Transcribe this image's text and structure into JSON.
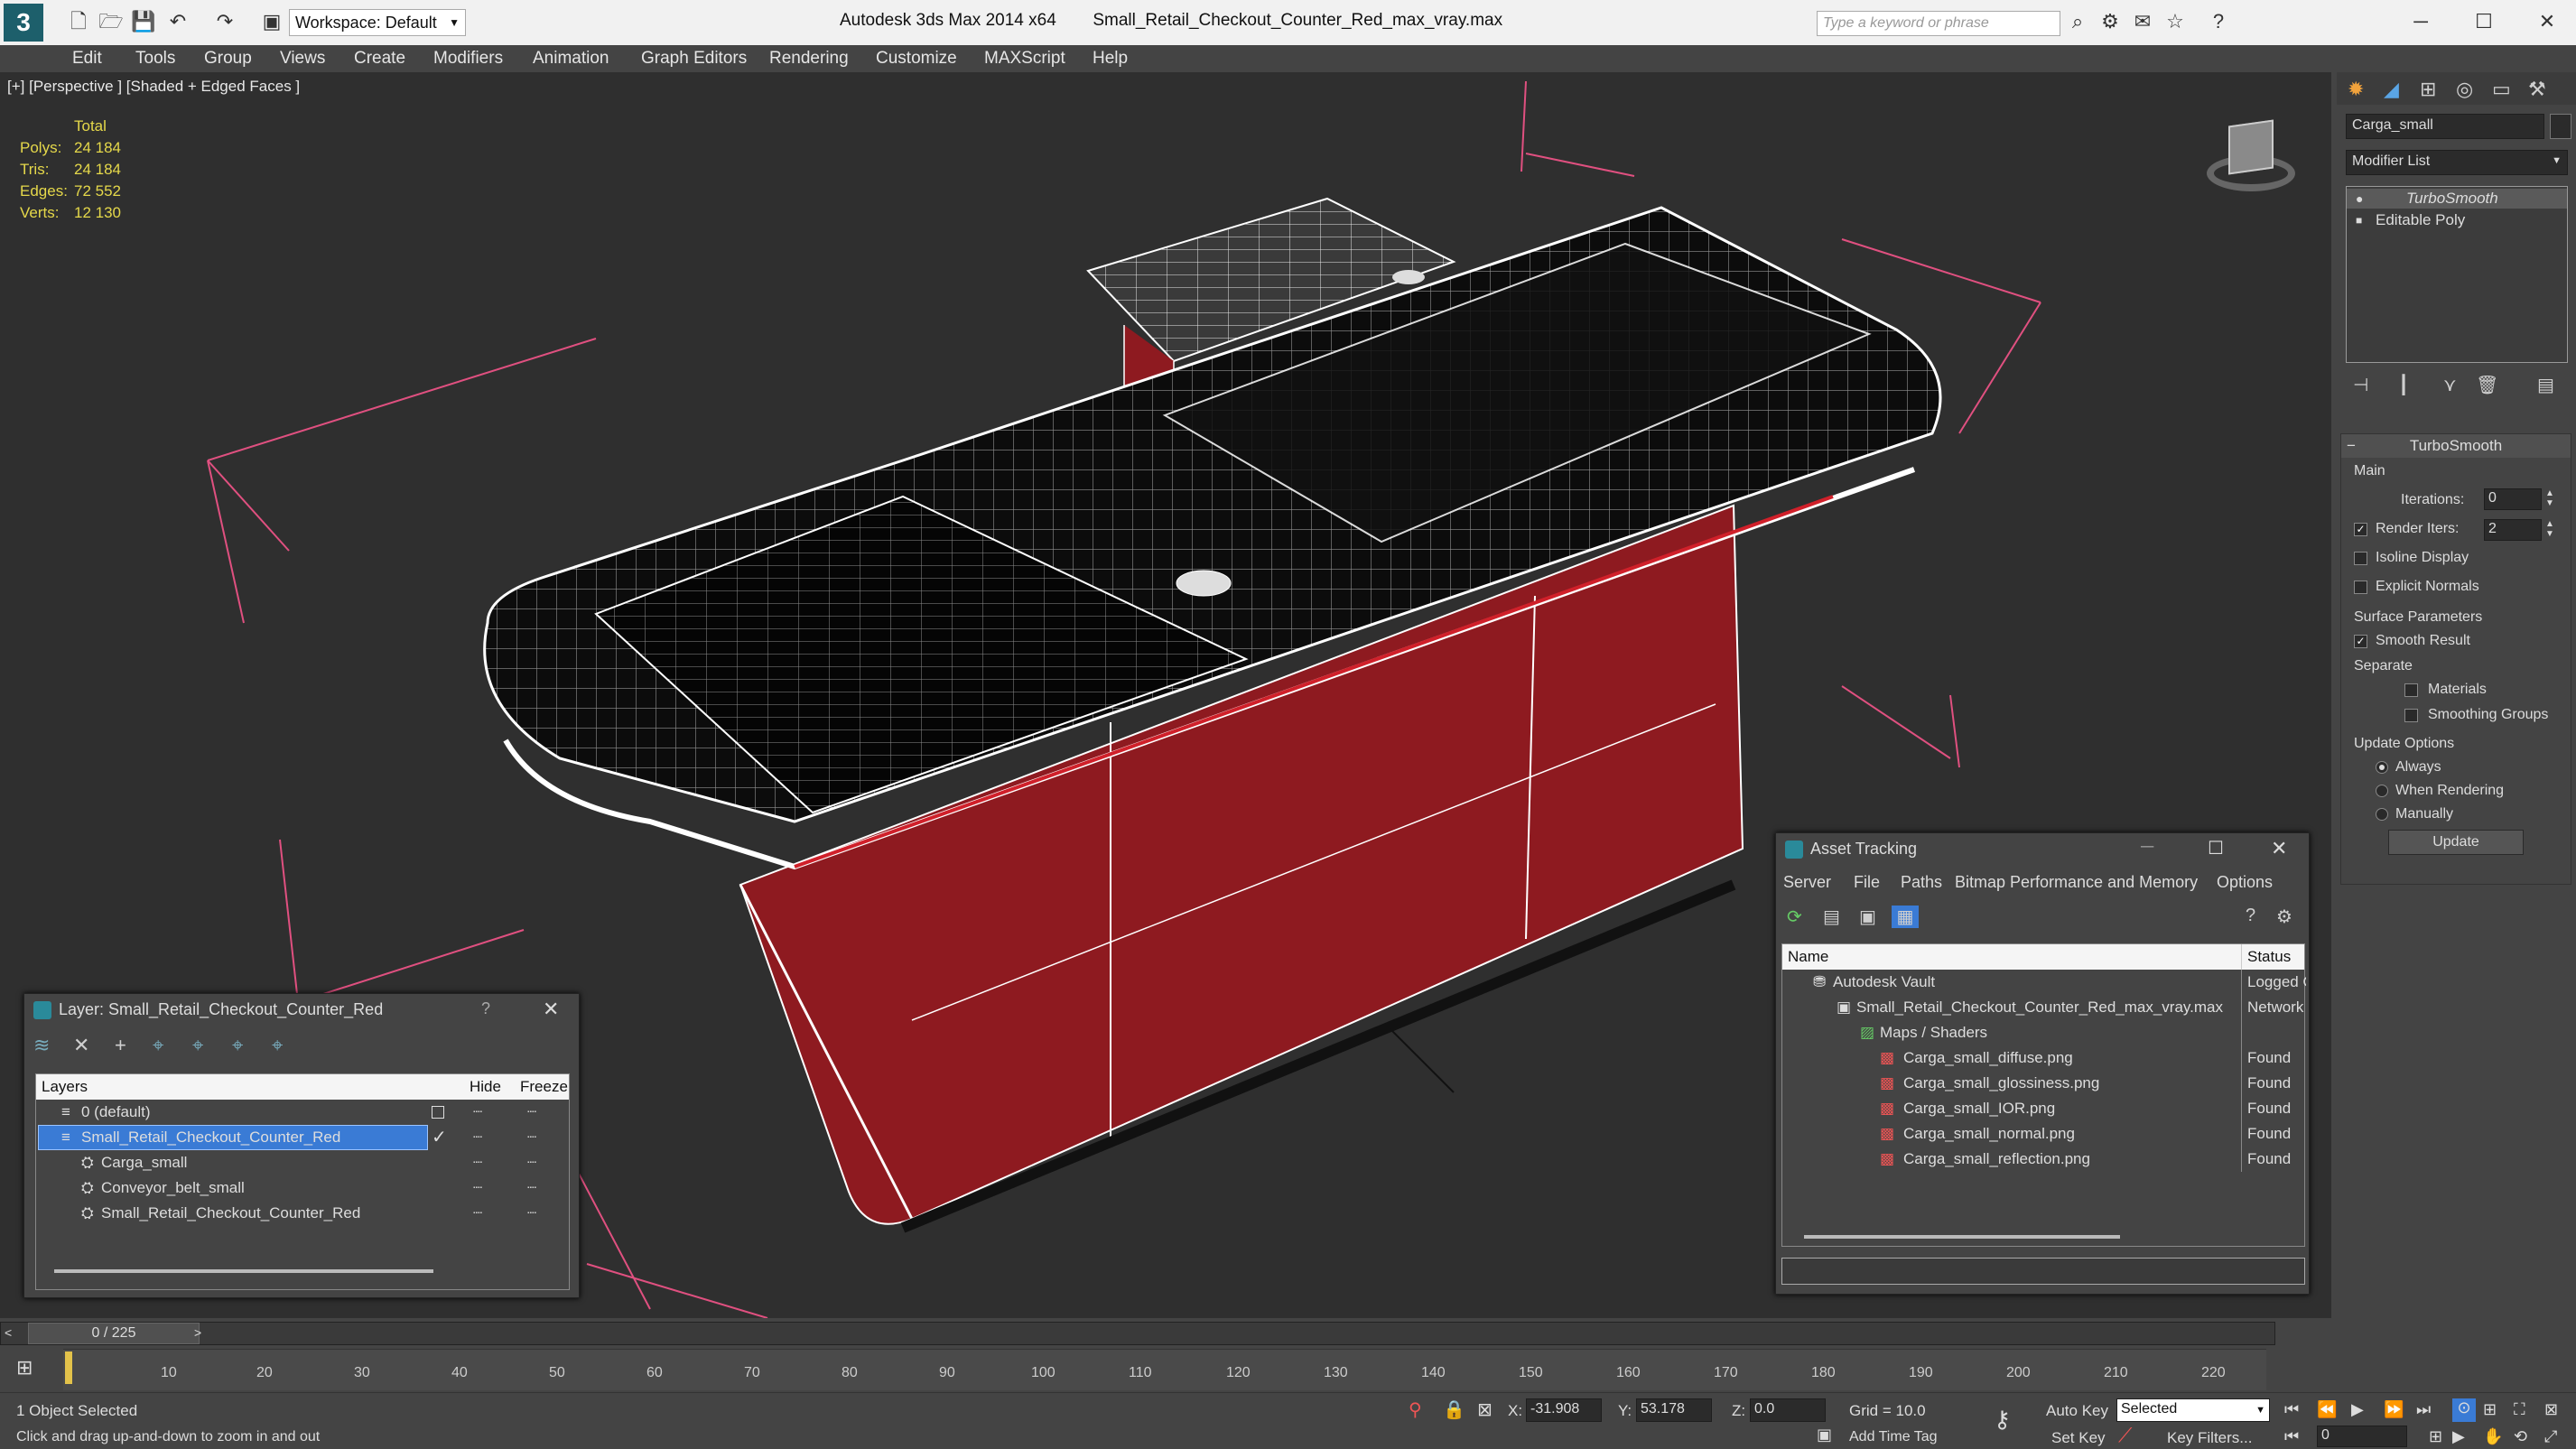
{
  "app": {
    "title": "Autodesk 3ds Max  2014 x64",
    "file": "Small_Retail_Checkout_Counter_Red_max_vray.max",
    "workspace": "Workspace: Default",
    "search_placeholder": "Type a keyword or phrase"
  },
  "menu": [
    "Edit",
    "Tools",
    "Group",
    "Views",
    "Create",
    "Modifiers",
    "Animation",
    "Graph Editors",
    "Rendering",
    "Customize",
    "MAXScript",
    "Help"
  ],
  "viewport": {
    "label": "[+] [Perspective ] [Shaded + Edged Faces ]",
    "stats": {
      "header": "Total",
      "rows": [
        {
          "label": "Polys:",
          "value": "24 184"
        },
        {
          "label": "Tris:",
          "value": "24 184"
        },
        {
          "label": "Edges:",
          "value": "72 552"
        },
        {
          "label": "Verts:",
          "value": "12 130"
        }
      ]
    }
  },
  "command_panel": {
    "object_name": "Carga_small",
    "modifier_list": "Modifier List",
    "stack": [
      "TurboSmooth",
      "Editable Poly"
    ],
    "rollout_title": "TurboSmooth",
    "main_label": "Main",
    "iterations_label": "Iterations:",
    "iterations_value": "0",
    "render_iters_label": "Render Iters:",
    "render_iters_value": "2",
    "isoline": "Isoline Display",
    "explicit_normals": "Explicit Normals",
    "surface_params": "Surface Parameters",
    "smooth_result": "Smooth Result",
    "separate": "Separate",
    "materials": "Materials",
    "smoothing_groups": "Smoothing Groups",
    "update_options": "Update Options",
    "always": "Always",
    "when_rendering": "When Rendering",
    "manually": "Manually",
    "update_button": "Update"
  },
  "layer_window": {
    "title": "Layer: Small_Retail_Checkout_Counter_Red",
    "help": "?",
    "columns": [
      "Layers",
      "Hide",
      "Freeze"
    ],
    "rows": [
      {
        "name": "0 (default)",
        "indent": 1,
        "selected": false
      },
      {
        "name": "Small_Retail_Checkout_Counter_Red",
        "indent": 1,
        "selected": true
      },
      {
        "name": "Carga_small",
        "indent": 2,
        "selected": false
      },
      {
        "name": "Conveyor_belt_small",
        "indent": 2,
        "selected": false
      },
      {
        "name": "Small_Retail_Checkout_Counter_Red",
        "indent": 2,
        "selected": false
      }
    ]
  },
  "asset_window": {
    "title": "Asset Tracking",
    "menu": [
      "Server",
      "File",
      "Paths",
      "Bitmap Performance and Memory",
      "Options"
    ],
    "columns": [
      "Name",
      "Status"
    ],
    "rows": [
      {
        "name": "Autodesk Vault",
        "status": "Logged O",
        "indent": 1
      },
      {
        "name": "Small_Retail_Checkout_Counter_Red_max_vray.max",
        "status": "Network",
        "indent": 2
      },
      {
        "name": "Maps / Shaders",
        "status": "",
        "indent": 3
      },
      {
        "name": "Carga_small_diffuse.png",
        "status": "Found",
        "indent": 4
      },
      {
        "name": "Carga_small_glossiness.png",
        "status": "Found",
        "indent": 4
      },
      {
        "name": "Carga_small_IOR.png",
        "status": "Found",
        "indent": 4
      },
      {
        "name": "Carga_small_normal.png",
        "status": "Found",
        "indent": 4
      },
      {
        "name": "Carga_small_reflection.png",
        "status": "Found",
        "indent": 4
      }
    ]
  },
  "timeline": {
    "frame": "0 / 225",
    "ticks": [
      "10",
      "20",
      "30",
      "40",
      "50",
      "60",
      "70",
      "80",
      "90",
      "100",
      "110",
      "120",
      "130",
      "140",
      "150",
      "160",
      "170",
      "180",
      "190",
      "200",
      "210",
      "220"
    ]
  },
  "status": {
    "selected": "1 Object Selected",
    "hint": "Click and drag up-and-down to zoom in and out",
    "x_label": "X:",
    "x_value": "-31.908",
    "y_label": "Y:",
    "y_value": "53.178",
    "z_label": "Z:",
    "z_value": "0.0",
    "grid": "Grid = 10.0",
    "auto_key": "Auto Key",
    "set_key": "Set Key",
    "selected_dropdown": "Selected",
    "key_filters": "Key Filters...",
    "add_time_tag": "Add Time Tag",
    "frame_field": "0"
  },
  "colors": {
    "counter_red": "#8e1a20",
    "selection_blue": "#3a7bd5",
    "stats_yellow": "#e5d84a"
  }
}
